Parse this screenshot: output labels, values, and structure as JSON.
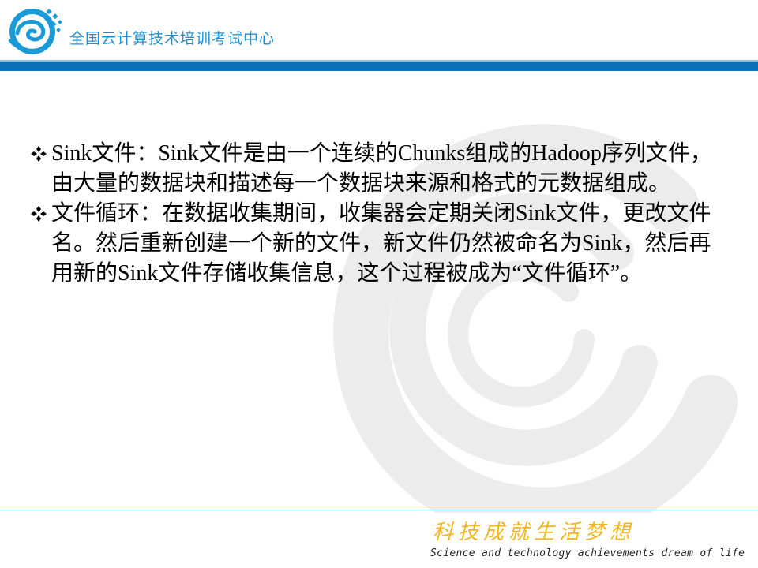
{
  "header": {
    "title": "全国云计算技术培训考试中心"
  },
  "bullets": [
    {
      "text": "Sink文件：Sink文件是由一个连续的Chunks组成的Hadoop序列文件，由大量的数据块和描述每一个数据块来源和格式的元数据组成。"
    },
    {
      "text": "文件循环：在数据收集期间，收集器会定期关闭Sink文件，更改文件名。然后重新创建一个新的文件，新文件仍然被命名为Sink，然后再用新的Sink文件存储收集信息，这个过程被成为“文件循环”。"
    }
  ],
  "footer": {
    "slogan_cn": "科技成就生活梦想",
    "slogan_en": "Science and technology achievements dream of life"
  },
  "colors": {
    "brand_blue": "#0b6fb8",
    "header_text": "#1f8fd0",
    "slogan_gold": "#f2b51e"
  },
  "icons": {
    "logo": "swirl-logo-icon",
    "bullet": "diamond-bullet-icon",
    "watermark": "swirl-watermark-icon"
  }
}
